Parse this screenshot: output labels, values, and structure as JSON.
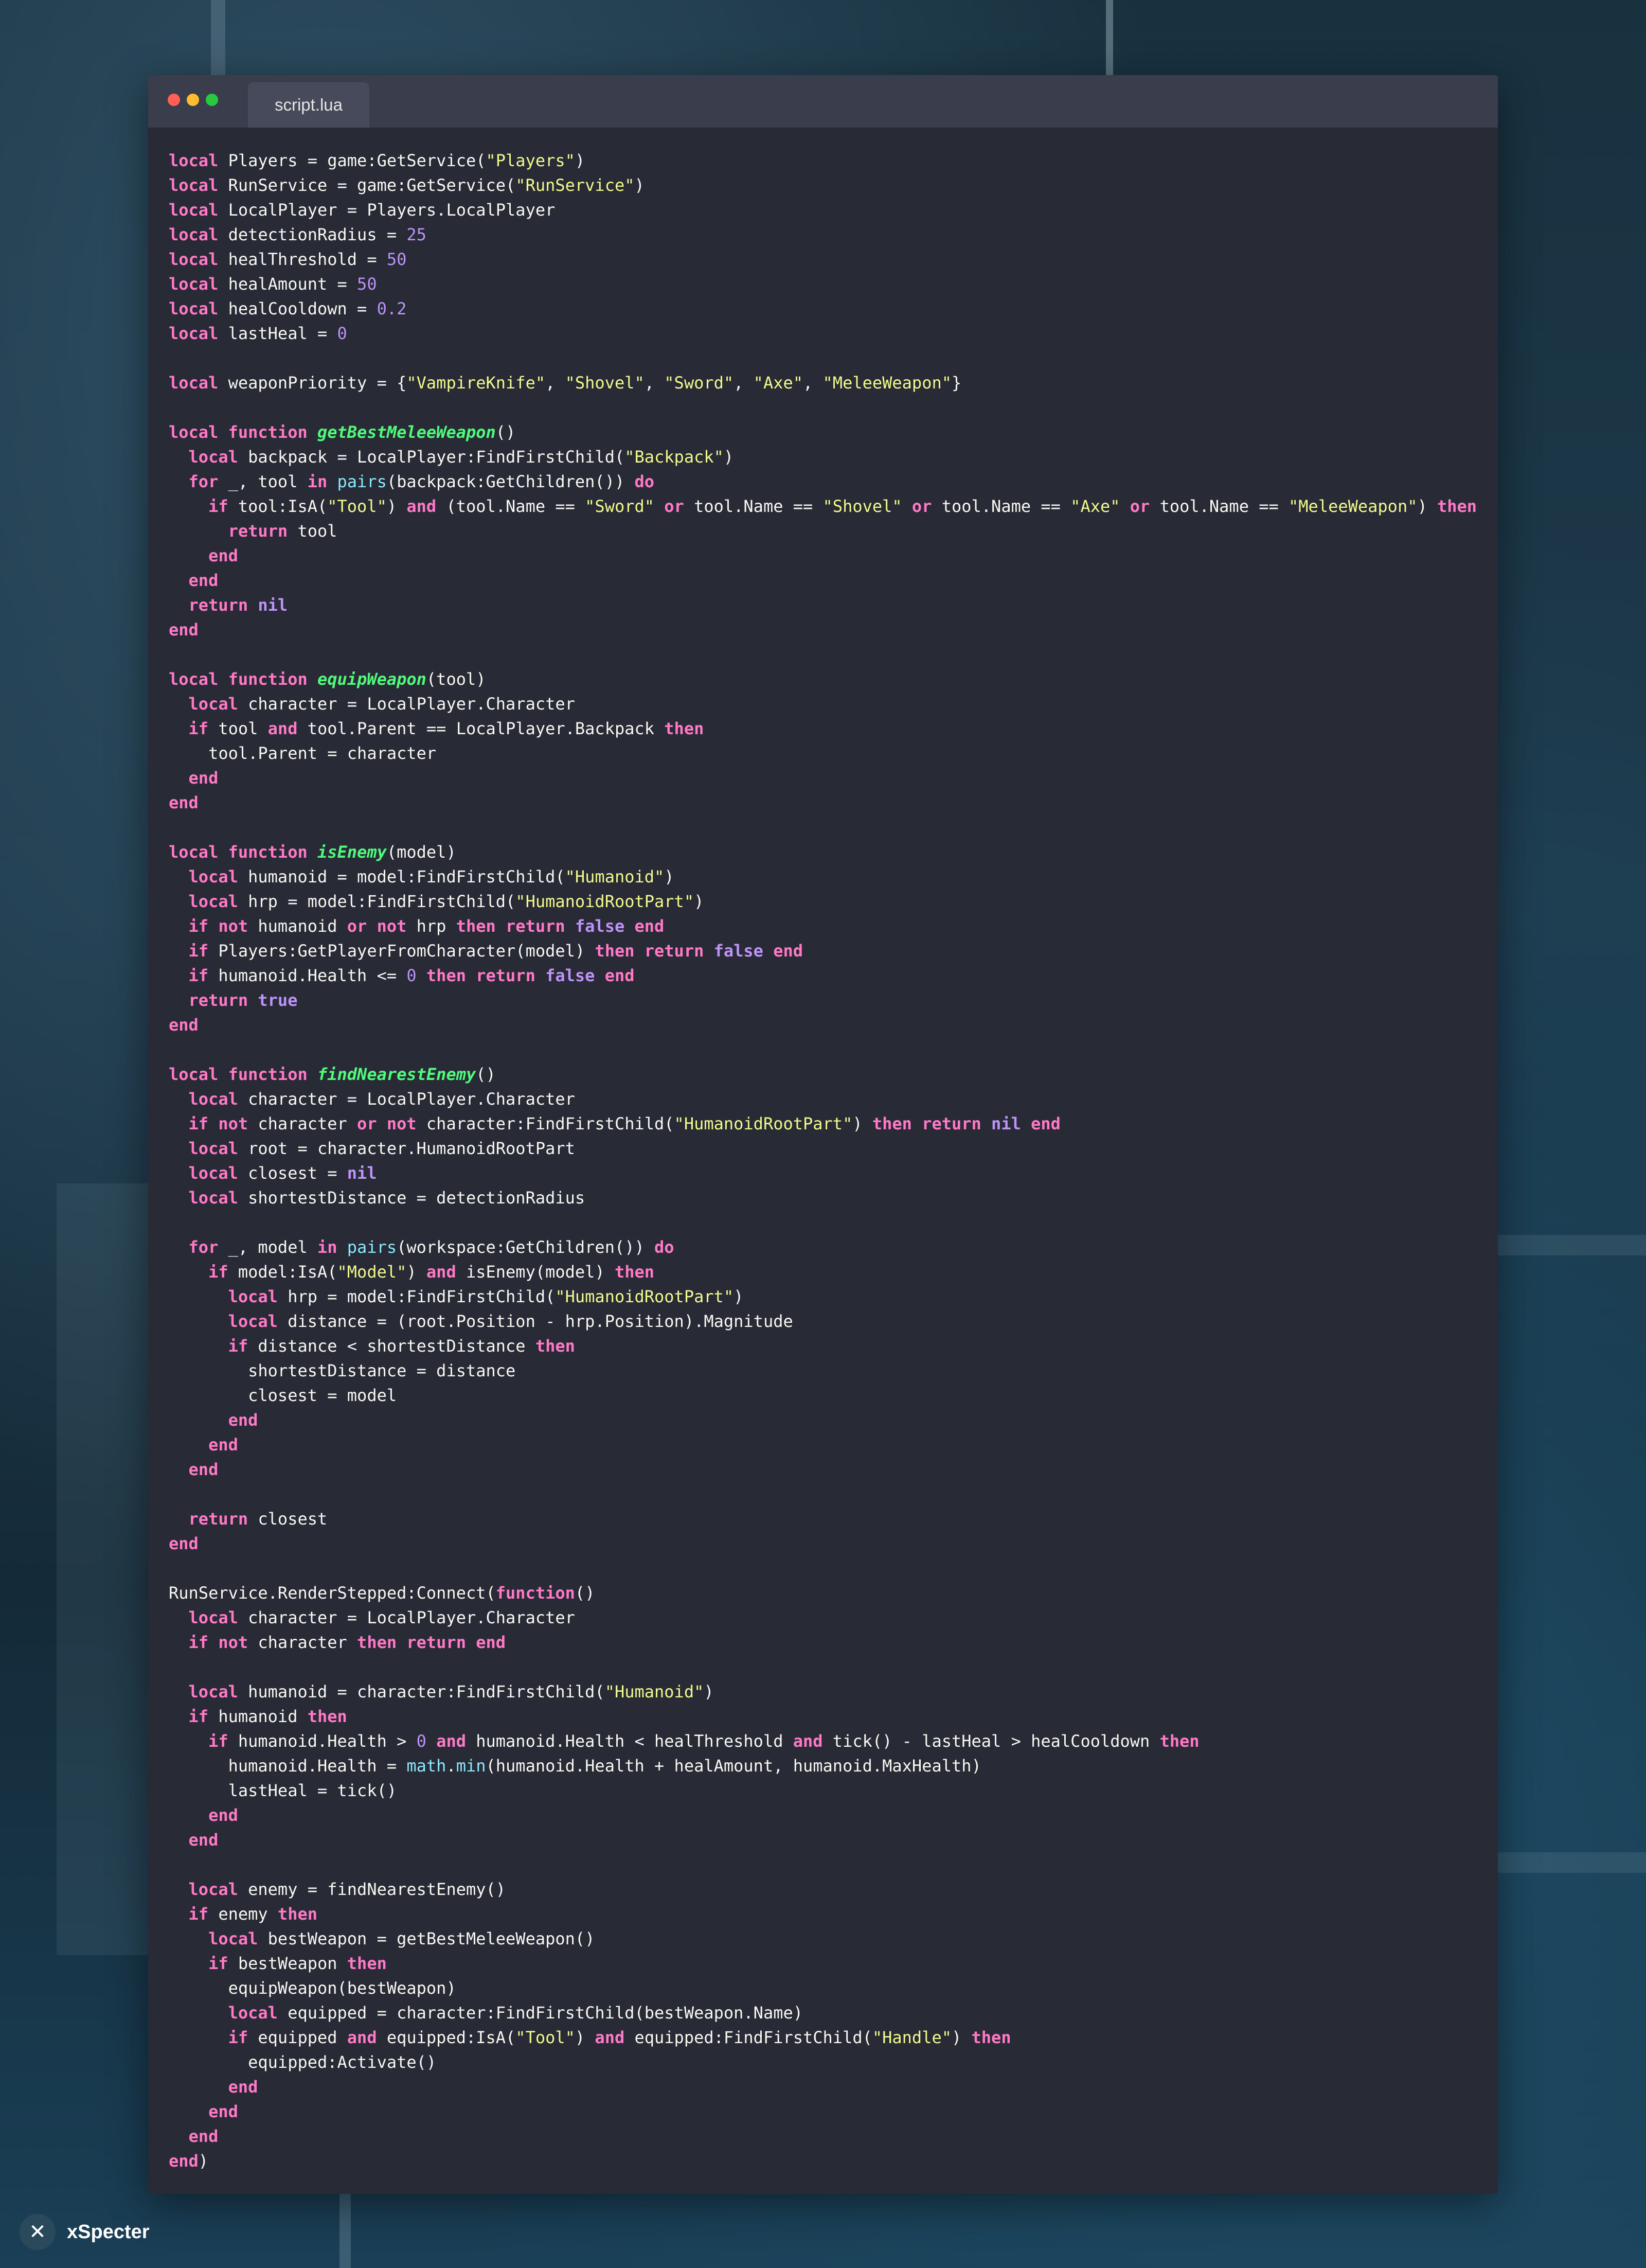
{
  "editor": {
    "tab_title": "script.lua",
    "language": "lua",
    "theme_colors": {
      "keyword": "#ff79c6",
      "string": "#f1fa8c",
      "number": "#bd93f9",
      "function_name": "#50fa7b",
      "builtin": "#8be9fd",
      "text": "#f8f8f2",
      "background": "#282a36"
    },
    "code_lines": [
      "local Players = game:GetService(\"Players\")",
      "local RunService = game:GetService(\"RunService\")",
      "local LocalPlayer = Players.LocalPlayer",
      "local detectionRadius = 25",
      "local healThreshold = 50",
      "local healAmount = 50",
      "local healCooldown = 0.2",
      "local lastHeal = 0",
      "",
      "local weaponPriority = {\"VampireKnife\", \"Shovel\", \"Sword\", \"Axe\", \"MeleeWeapon\"}",
      "",
      "local function getBestMeleeWeapon()",
      "  local backpack = LocalPlayer:FindFirstChild(\"Backpack\")",
      "  for _, tool in pairs(backpack:GetChildren()) do",
      "    if tool:IsA(\"Tool\") and (tool.Name == \"Sword\" or tool.Name == \"Shovel\" or tool.Name == \"Axe\" or tool.Name == \"MeleeWeapon\") then",
      "      return tool",
      "    end",
      "  end",
      "  return nil",
      "end",
      "",
      "local function equipWeapon(tool)",
      "  local character = LocalPlayer.Character",
      "  if tool and tool.Parent == LocalPlayer.Backpack then",
      "    tool.Parent = character",
      "  end",
      "end",
      "",
      "local function isEnemy(model)",
      "  local humanoid = model:FindFirstChild(\"Humanoid\")",
      "  local hrp = model:FindFirstChild(\"HumanoidRootPart\")",
      "  if not humanoid or not hrp then return false end",
      "  if Players:GetPlayerFromCharacter(model) then return false end",
      "  if humanoid.Health <= 0 then return false end",
      "  return true",
      "end",
      "",
      "local function findNearestEnemy()",
      "  local character = LocalPlayer.Character",
      "  if not character or not character:FindFirstChild(\"HumanoidRootPart\") then return nil end",
      "  local root = character.HumanoidRootPart",
      "  local closest = nil",
      "  local shortestDistance = detectionRadius",
      "",
      "  for _, model in pairs(workspace:GetChildren()) do",
      "    if model:IsA(\"Model\") and isEnemy(model) then",
      "      local hrp = model:FindFirstChild(\"HumanoidRootPart\")",
      "      local distance = (root.Position - hrp.Position).Magnitude",
      "      if distance < shortestDistance then",
      "        shortestDistance = distance",
      "        closest = model",
      "      end",
      "    end",
      "  end",
      "",
      "  return closest",
      "end",
      "",
      "RunService.RenderStepped:Connect(function()",
      "  local character = LocalPlayer.Character",
      "  if not character then return end",
      "",
      "  local humanoid = character:FindFirstChild(\"Humanoid\")",
      "  if humanoid then",
      "    if humanoid.Health > 0 and humanoid.Health < healThreshold and tick() - lastHeal > healCooldown then",
      "      humanoid.Health = math.min(humanoid.Health + healAmount, humanoid.MaxHealth)",
      "      lastHeal = tick()",
      "    end",
      "  end",
      "",
      "  local enemy = findNearestEnemy()",
      "  if enemy then",
      "    local bestWeapon = getBestMeleeWeapon()",
      "    if bestWeapon then",
      "      equipWeapon(bestWeapon)",
      "      local equipped = character:FindFirstChild(bestWeapon.Name)",
      "      if equipped and equipped:IsA(\"Tool\") and equipped:FindFirstChild(\"Handle\") then",
      "        equipped:Activate()",
      "      end",
      "    end",
      "  end",
      "end)"
    ]
  },
  "branding": {
    "logo_glyph": "✕",
    "name": "xSpecter"
  }
}
